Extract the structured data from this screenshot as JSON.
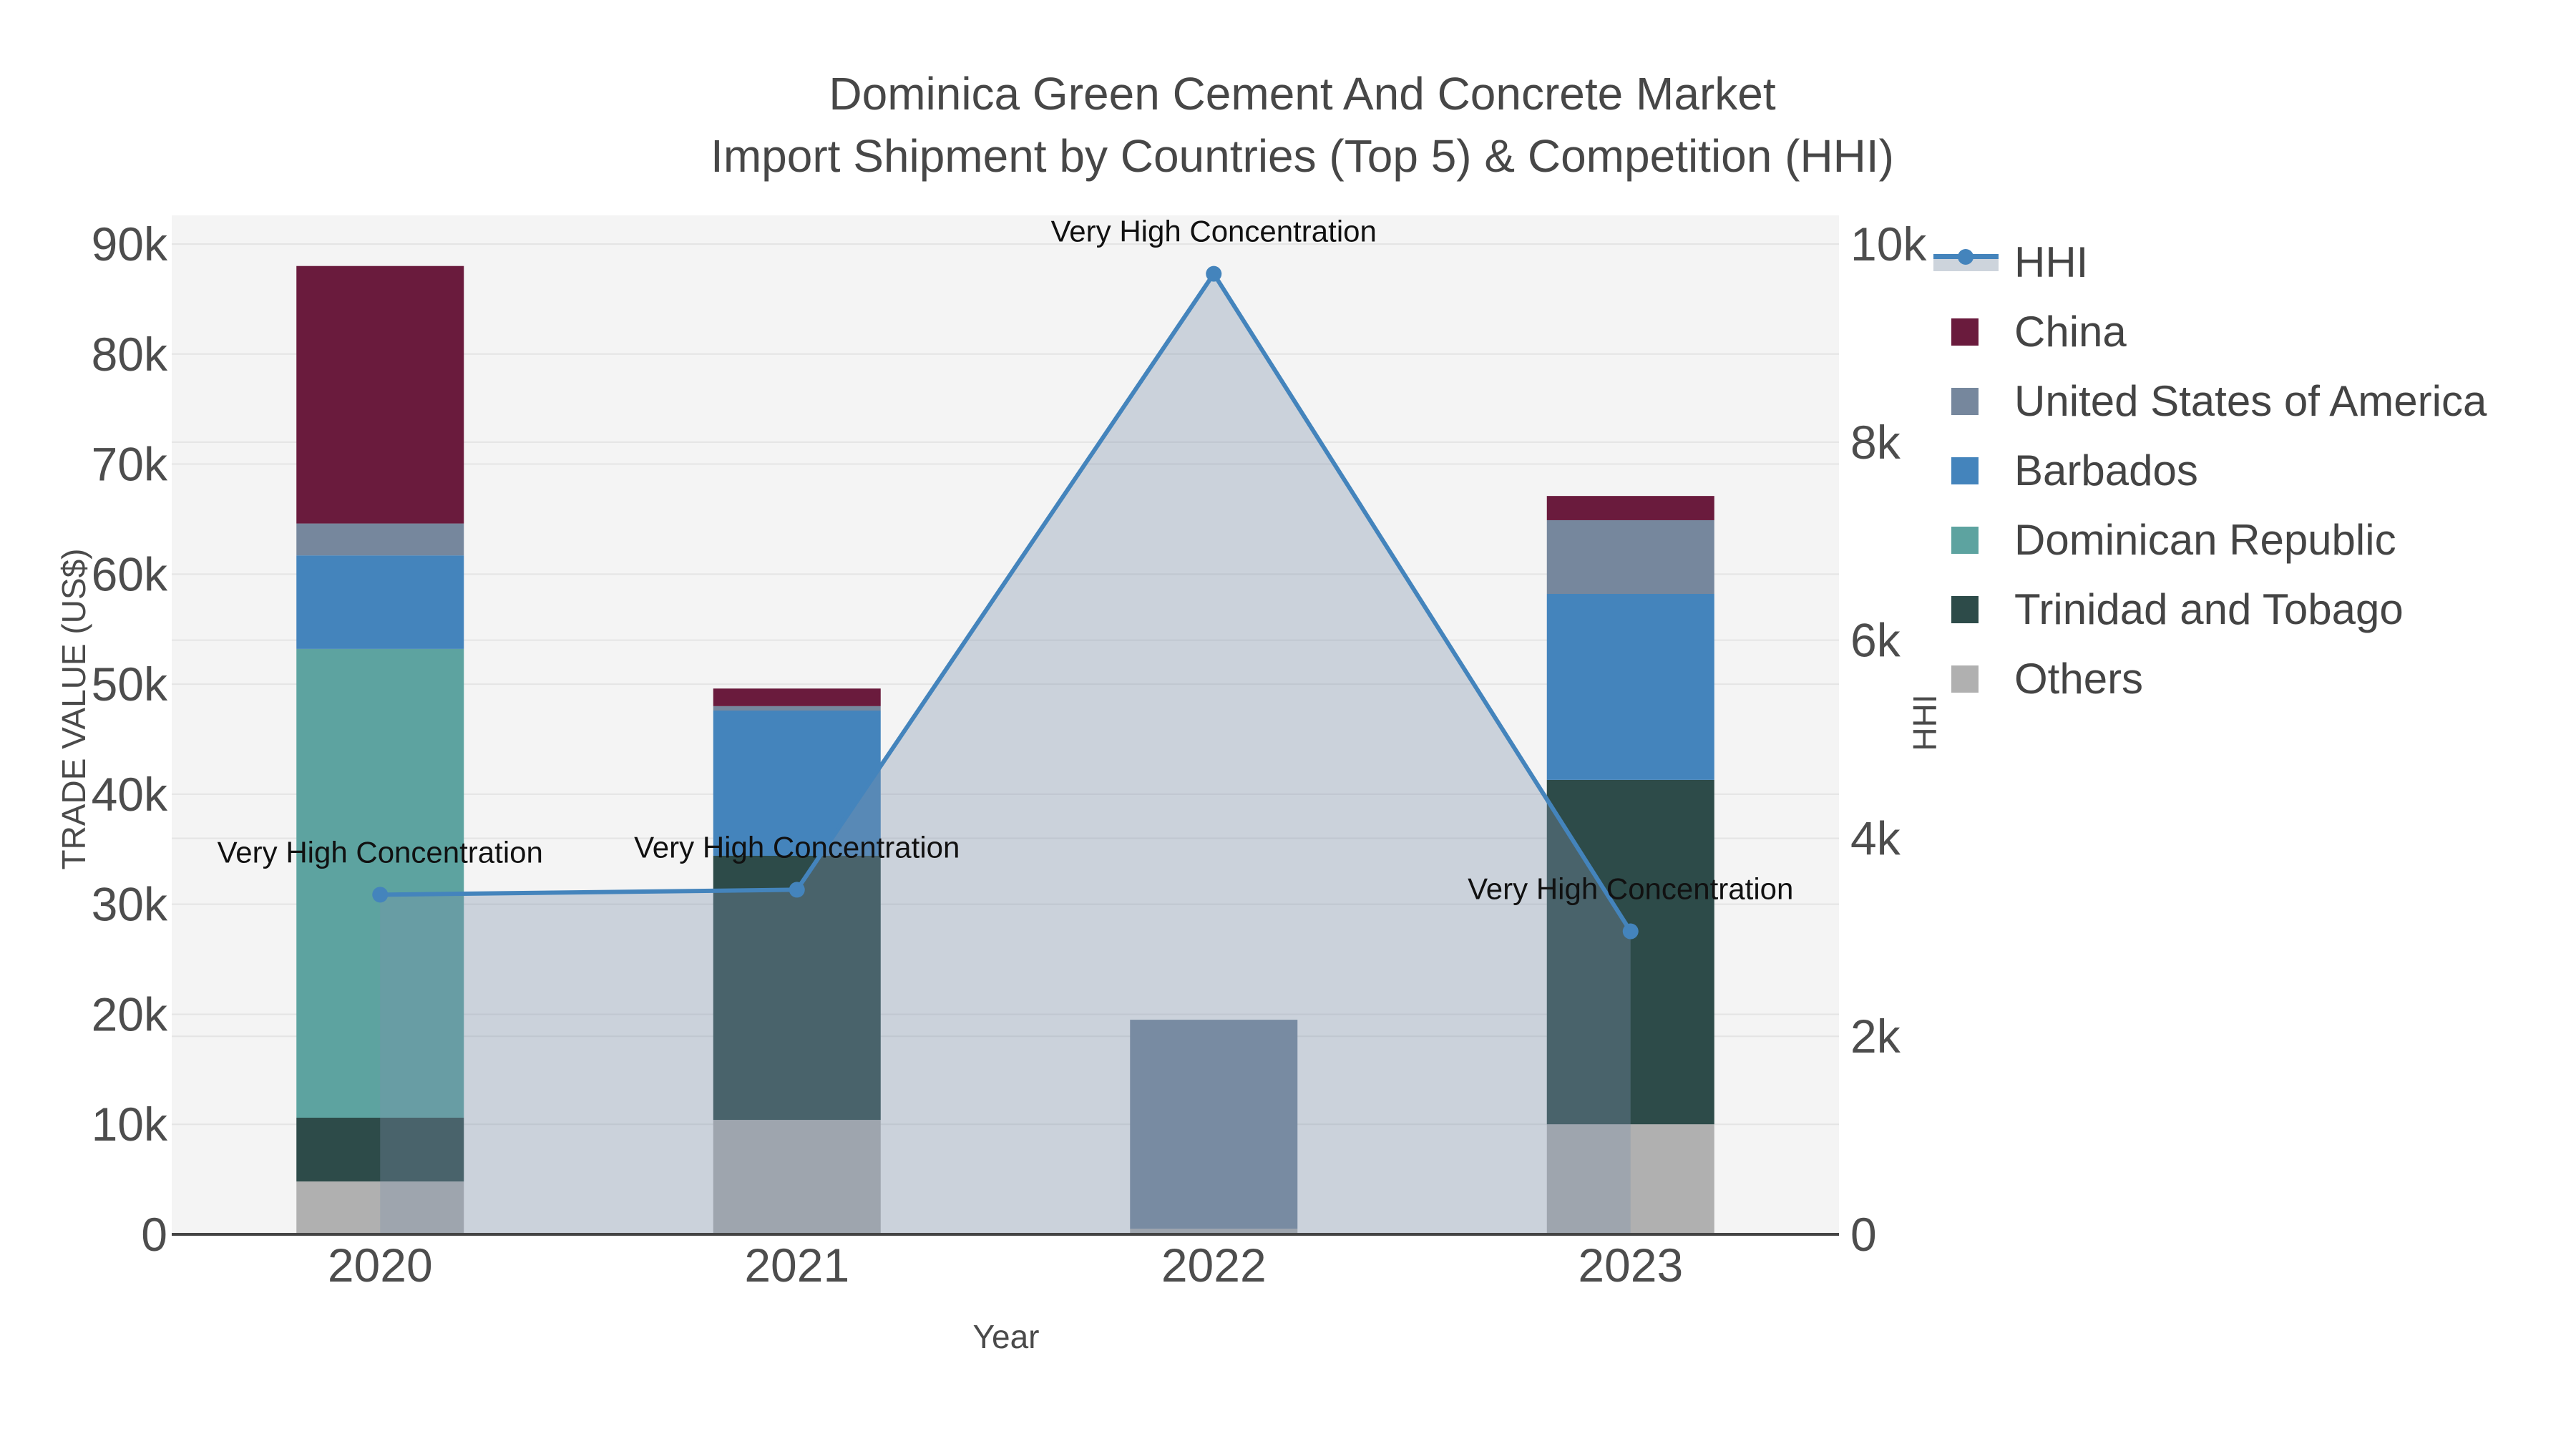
{
  "title": {
    "line1": "Dominica Green Cement And Concrete Market",
    "line2": "Import Shipment by Countries (Top 5) & Competition (HHI)"
  },
  "axes": {
    "x": {
      "title": "Year"
    },
    "y_left": {
      "title": "TRADE VALUE (US$)",
      "tick_labels": [
        "0",
        "10k",
        "20k",
        "30k",
        "40k",
        "50k",
        "60k",
        "70k",
        "80k",
        "90k"
      ],
      "tick_step": 10000
    },
    "y_right": {
      "title": "HHI",
      "tick_labels": [
        "0",
        "2k",
        "4k",
        "6k",
        "8k",
        "10k"
      ],
      "tick_step": 2000
    }
  },
  "legend_order": [
    "HHI",
    "China",
    "United States of America",
    "Barbados",
    "Dominican Republic",
    "Trinidad and Tobago",
    "Others"
  ],
  "chart_data": {
    "type": "bar+line",
    "categories": [
      "2020",
      "2021",
      "2022",
      "2023"
    ],
    "stack_order": [
      "Others",
      "Trinidad and Tobago",
      "Dominican Republic",
      "Barbados",
      "United States of America",
      "China"
    ],
    "series": [
      {
        "name": "China",
        "type": "bar",
        "color": "#6A1B3D",
        "values": [
          23400,
          1600,
          0,
          2200
        ]
      },
      {
        "name": "United States of America",
        "type": "bar",
        "color": "#76879D",
        "values": [
          2900,
          400,
          19000,
          6700
        ]
      },
      {
        "name": "Barbados",
        "type": "bar",
        "color": "#4484BC",
        "values": [
          8500,
          13200,
          0,
          16900
        ]
      },
      {
        "name": "Dominican Republic",
        "type": "bar",
        "color": "#5DA3A0",
        "values": [
          42600,
          0,
          0,
          0
        ]
      },
      {
        "name": "Trinidad and Tobago",
        "type": "bar",
        "color": "#2D4B49",
        "values": [
          5800,
          24000,
          0,
          31300
        ]
      },
      {
        "name": "Others",
        "type": "bar",
        "color": "#B0B0B0",
        "values": [
          4800,
          10400,
          500,
          10000
        ]
      }
    ],
    "hhi_line": {
      "name": "HHI",
      "type": "line",
      "color": "#4484BC",
      "area_fill": "rgba(125,145,173,0.35)",
      "values": [
        3430,
        3480,
        9700,
        3060
      ]
    },
    "annotations": [
      {
        "text": "Very High Concentration",
        "category": "2020"
      },
      {
        "text": "Very High Concentration",
        "category": "2021"
      },
      {
        "text": "Very High Concentration",
        "category": "2022"
      },
      {
        "text": "Very High Concentration",
        "category": "2023"
      }
    ],
    "ylim_left": [
      0,
      92600
    ],
    "ylim_right": [
      0,
      10290
    ],
    "title": "Dominica Green Cement And Concrete Market Import Shipment by Countries (Top 5) & Competition (HHI)",
    "xlabel": "Year",
    "ylabel_left": "TRADE VALUE (US$)",
    "ylabel_right": "HHI",
    "grid": true,
    "legend_position": "right"
  },
  "style": {
    "plot_bg": "#F4F4F4",
    "grid_color": "#E4E4E4",
    "axis_line_color": "#444444",
    "tick_color": "#4D4D4D",
    "annotation_color": "#111111"
  }
}
